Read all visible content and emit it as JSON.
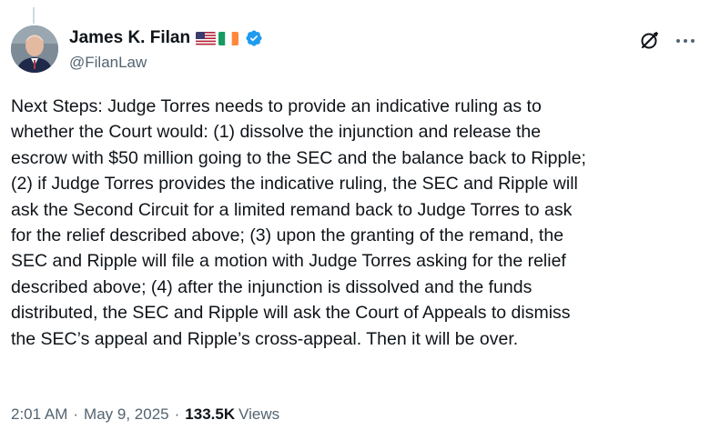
{
  "author": {
    "display_name": "James K. Filan",
    "handle": "@FilanLaw",
    "flags": [
      "us-flag",
      "ireland-flag"
    ],
    "verified": true
  },
  "tweet": {
    "text": "Next Steps:  Judge Torres needs to provide an indicative ruling as to\nwhether the Court would: (1) dissolve the injunction and release the\nescrow with $50 million going to the SEC and the balance back to Ripple;\n(2) if Judge Torres provides the indicative ruling, the SEC and Ripple will\nask the Second Circuit for a limited remand back to Judge Torres to ask\nfor the relief described above; (3) upon the granting of the remand, the\nSEC and Ripple will file a motion with Judge Torres asking for the relief\ndescribed above; (4) after the injunction is dissolved and the funds\ndistributed, the SEC and Ripple will ask the Court of Appeals to dismiss\nthe SEC’s appeal and Ripple’s cross-appeal.  Then it will be over."
  },
  "meta": {
    "time": "2:01 AM",
    "date": "May 9, 2025",
    "separator": "·",
    "views_count": "133.5K",
    "views_label": "Views"
  },
  "colors": {
    "text": "#0f1419",
    "secondary": "#536471",
    "verified": "#1d9bf0"
  },
  "icons": {
    "grok": "grok-icon",
    "more": "more-icon"
  }
}
